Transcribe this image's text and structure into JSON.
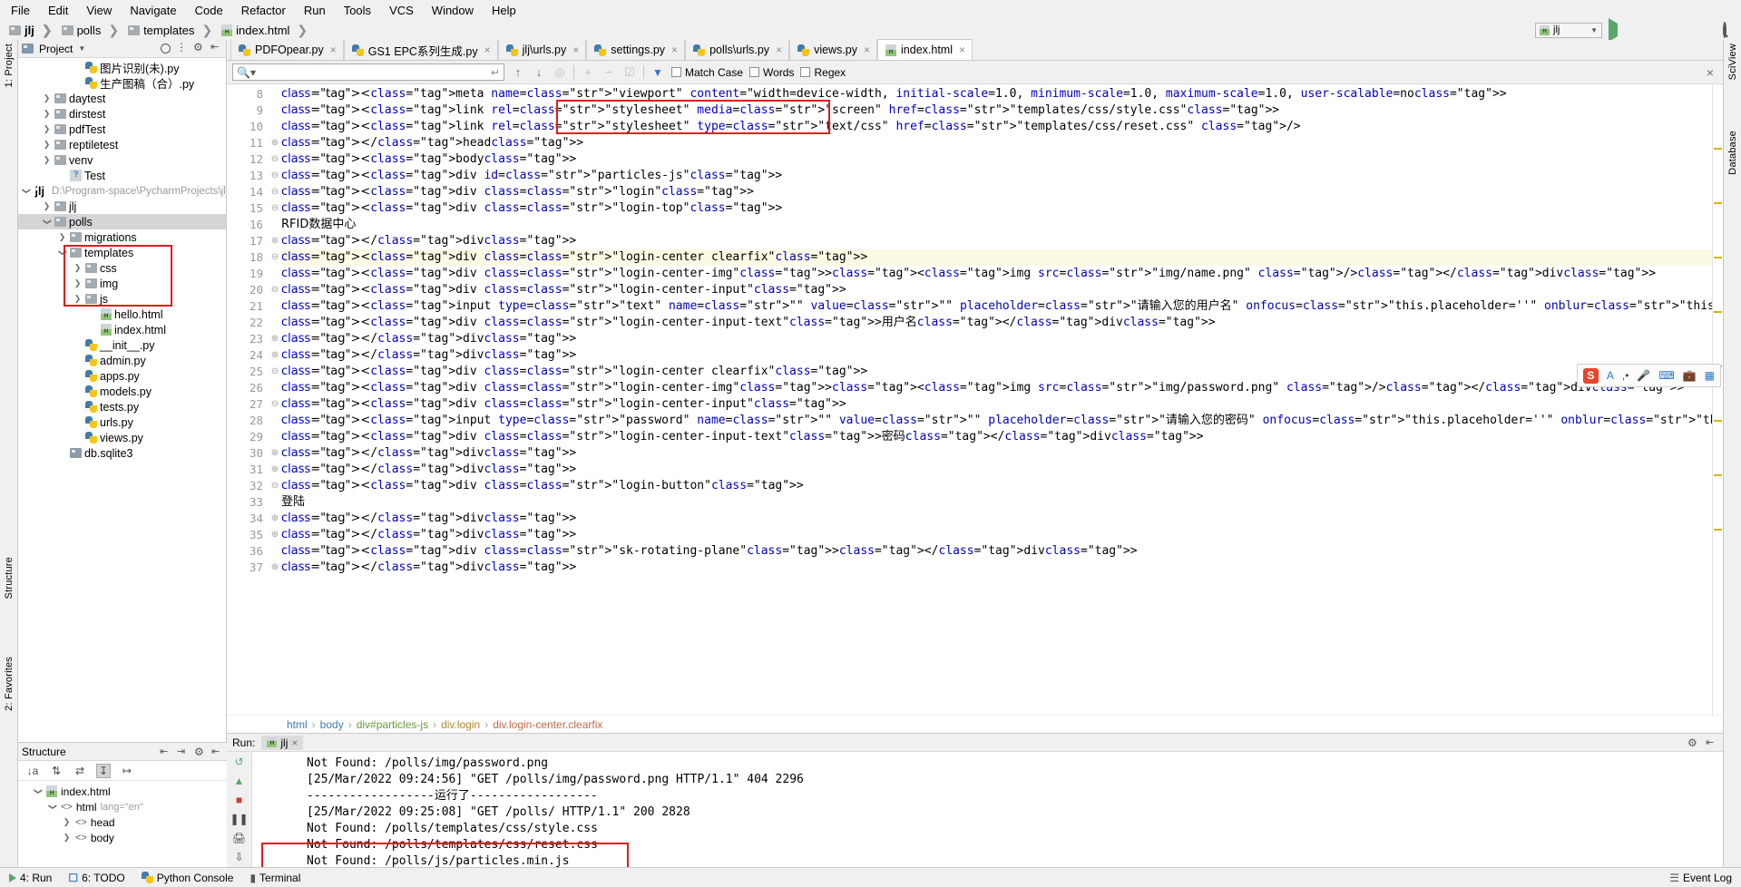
{
  "menubar": {
    "items": [
      "File",
      "Edit",
      "View",
      "Navigate",
      "Code",
      "Refactor",
      "Run",
      "Tools",
      "VCS",
      "Window",
      "Help"
    ]
  },
  "breadcrumb": {
    "items": [
      "jlj",
      "polls",
      "templates",
      "index.html"
    ]
  },
  "toprightbar": {
    "run_config": "jlj",
    "icons": [
      "run-icon",
      "debug-icon",
      "coverage-icon",
      "profile-icon",
      "build-icon",
      "stop-icon",
      "search-everywhere-icon"
    ]
  },
  "project_panel": {
    "title": "Project",
    "tree": [
      {
        "indent": 3,
        "arrow": "none",
        "icon": "python-file-icon",
        "label": "图片识别(未).py",
        "path": ""
      },
      {
        "indent": 3,
        "arrow": "none",
        "icon": "python-file-icon",
        "label": "生产图稿（合）.py",
        "path": ""
      },
      {
        "indent": 1,
        "arrow": "right",
        "icon": "folder-icon",
        "label": "daytest",
        "path": ""
      },
      {
        "indent": 1,
        "arrow": "right",
        "icon": "folder-icon",
        "label": "dirstest",
        "path": ""
      },
      {
        "indent": 1,
        "arrow": "right",
        "icon": "folder-icon",
        "label": "pdfTest",
        "path": ""
      },
      {
        "indent": 1,
        "arrow": "right",
        "icon": "folder-icon",
        "label": "reptiletest",
        "path": ""
      },
      {
        "indent": 1,
        "arrow": "right",
        "icon": "folder-icon",
        "label": "venv",
        "path": ""
      },
      {
        "indent": 2,
        "arrow": "none",
        "icon": "unknown-file-icon",
        "label": "Test",
        "path": ""
      },
      {
        "indent": 0,
        "arrow": "down",
        "icon": "module-icon",
        "label": "jlj",
        "path": "D:\\Program-space\\PycharmProjects\\jlj",
        "bold": true
      },
      {
        "indent": 1,
        "arrow": "right",
        "icon": "folder-icon",
        "label": "jlj",
        "path": ""
      },
      {
        "indent": 1,
        "arrow": "down",
        "icon": "folder-icon",
        "label": "polls",
        "path": "",
        "selected": true
      },
      {
        "indent": 2,
        "arrow": "right",
        "icon": "folder-icon",
        "label": "migrations",
        "path": ""
      },
      {
        "indent": 2,
        "arrow": "down",
        "icon": "folder-icon",
        "label": "templates",
        "path": ""
      },
      {
        "indent": 3,
        "arrow": "right",
        "icon": "folder-icon",
        "label": "css",
        "path": ""
      },
      {
        "indent": 3,
        "arrow": "right",
        "icon": "folder-icon",
        "label": "img",
        "path": ""
      },
      {
        "indent": 3,
        "arrow": "right",
        "icon": "folder-icon",
        "label": "js",
        "path": ""
      },
      {
        "indent": 4,
        "arrow": "none",
        "icon": "html-file-icon",
        "label": "hello.html",
        "path": ""
      },
      {
        "indent": 4,
        "arrow": "none",
        "icon": "html-file-icon",
        "label": "index.html",
        "path": ""
      },
      {
        "indent": 3,
        "arrow": "none",
        "icon": "python-file-icon",
        "label": "__init__.py",
        "path": ""
      },
      {
        "indent": 3,
        "arrow": "none",
        "icon": "python-file-icon",
        "label": "admin.py",
        "path": ""
      },
      {
        "indent": 3,
        "arrow": "none",
        "icon": "python-file-icon",
        "label": "apps.py",
        "path": ""
      },
      {
        "indent": 3,
        "arrow": "none",
        "icon": "python-file-icon",
        "label": "models.py",
        "path": ""
      },
      {
        "indent": 3,
        "arrow": "none",
        "icon": "python-file-icon",
        "label": "tests.py",
        "path": ""
      },
      {
        "indent": 3,
        "arrow": "none",
        "icon": "python-file-icon",
        "label": "urls.py",
        "path": ""
      },
      {
        "indent": 3,
        "arrow": "none",
        "icon": "python-file-icon",
        "label": "views.py",
        "path": ""
      },
      {
        "indent": 2,
        "arrow": "none",
        "icon": "db-file-icon",
        "label": "db.sqlite3",
        "path": ""
      }
    ]
  },
  "structure_panel": {
    "title": "Structure",
    "tree": [
      {
        "indent": 0,
        "arrow": "down",
        "icon": "html-file-icon",
        "label": "index.html",
        "attr": ""
      },
      {
        "indent": 1,
        "arrow": "down",
        "icon": "tag-icon",
        "label": "html",
        "attr": "lang=\"en\""
      },
      {
        "indent": 2,
        "arrow": "right",
        "icon": "tag-icon",
        "label": "head",
        "attr": ""
      },
      {
        "indent": 2,
        "arrow": "right",
        "icon": "tag-icon",
        "label": "body",
        "attr": ""
      }
    ]
  },
  "editor_tabs": [
    {
      "label": "PDFOpear.py",
      "icon": "python-file-icon",
      "active": false
    },
    {
      "label": "GS1 EPC系列生成.py",
      "icon": "python-file-icon",
      "active": false
    },
    {
      "label": "jlj\\urls.py",
      "icon": "python-file-icon",
      "active": false
    },
    {
      "label": "settings.py",
      "icon": "python-file-icon",
      "active": false
    },
    {
      "label": "polls\\urls.py",
      "icon": "python-file-icon",
      "active": false
    },
    {
      "label": "views.py",
      "icon": "python-file-icon",
      "active": false
    },
    {
      "label": "index.html",
      "icon": "html-file-icon",
      "active": true
    }
  ],
  "findbar": {
    "query": "",
    "match_case": "Match Case",
    "words": "Words",
    "regex": "Regex",
    "icons": [
      "prev-match-icon",
      "next-match-icon",
      "select-all-icon",
      "add-icon",
      "remove-icon",
      "select-occurrences-icon",
      "filter-icon",
      "close-icon"
    ]
  },
  "editor": {
    "first_line": 8,
    "lines": [
      {
        "n": 8,
        "fold": "none",
        "text": "<meta name=\"viewport\" content=\"width=device-width, initial-scale=1.0, minimum-scale=1.0, maximum-scale=1.0, user-scalable=no>"
      },
      {
        "n": 9,
        "fold": "none",
        "text": "<link rel=\"stylesheet\" media=\"screen\" href=\"templates/css/style.css\">"
      },
      {
        "n": 10,
        "fold": "none",
        "text": "<link rel=\"stylesheet\" type=\"text/css\" href=\"templates/css/reset.css\" />"
      },
      {
        "n": 11,
        "fold": "end",
        "text": "</head>"
      },
      {
        "n": 12,
        "fold": "start",
        "text": "<body>"
      },
      {
        "n": 13,
        "fold": "start",
        "text": "<div id=\"particles-js\">"
      },
      {
        "n": 14,
        "fold": "start",
        "text": "<div class=\"login\">"
      },
      {
        "n": 15,
        "fold": "start",
        "text": "<div class=\"login-top\">"
      },
      {
        "n": 16,
        "fold": "none",
        "text": "RFID数据中心"
      },
      {
        "n": 17,
        "fold": "end",
        "text": "</div>"
      },
      {
        "n": 18,
        "fold": "start",
        "text": "<div class=\"login-center clearfix\">",
        "highlight": true
      },
      {
        "n": 19,
        "fold": "none",
        "text": "<div class=\"login-center-img\"><img src=\"img/name.png\" /></div>"
      },
      {
        "n": 20,
        "fold": "start",
        "text": "<div class=\"login-center-input\">"
      },
      {
        "n": 21,
        "fold": "none",
        "text": "<input type=\"text\" name=\"\" value=\"\" placeholder=\"请输入您的用户名\" onfocus=\"this.placeholder=''\" onblur=\"this.placeholder='请输入您的用户名'\" />"
      },
      {
        "n": 22,
        "fold": "none",
        "text": "<div class=\"login-center-input-text\">用户名</div>"
      },
      {
        "n": 23,
        "fold": "end",
        "text": "</div>"
      },
      {
        "n": 24,
        "fold": "end",
        "text": "</div>"
      },
      {
        "n": 25,
        "fold": "start",
        "text": "<div class=\"login-center clearfix\">"
      },
      {
        "n": 26,
        "fold": "none",
        "text": "<div class=\"login-center-img\"><img src=\"img/password.png\" /></div>"
      },
      {
        "n": 27,
        "fold": "start",
        "text": "<div class=\"login-center-input\">"
      },
      {
        "n": 28,
        "fold": "none",
        "text": "<input type=\"password\" name=\"\" value=\"\" placeholder=\"请输入您的密码\" onfocus=\"this.placeholder=''\" onblur=\"this.placeholder='请输入您的密码'\" />"
      },
      {
        "n": 29,
        "fold": "none",
        "text": "<div class=\"login-center-input-text\">密码</div>"
      },
      {
        "n": 30,
        "fold": "end",
        "text": "</div>"
      },
      {
        "n": 31,
        "fold": "end",
        "text": "</div>"
      },
      {
        "n": 32,
        "fold": "start",
        "text": "<div class=\"login-button\">"
      },
      {
        "n": 33,
        "fold": "none",
        "text": "登陆"
      },
      {
        "n": 34,
        "fold": "end",
        "text": "</div>"
      },
      {
        "n": 35,
        "fold": "end",
        "text": "</div>"
      },
      {
        "n": 36,
        "fold": "none",
        "text": "<div class=\"sk-rotating-plane\"></div>"
      },
      {
        "n": 37,
        "fold": "end",
        "text": "</div>"
      }
    ],
    "code_breadcrumb": [
      "html",
      "body",
      "div#particles-js",
      "div.login",
      "div.login-center.clearfix"
    ]
  },
  "run_panel": {
    "label": "Run:",
    "tab": "jlj",
    "console_lines": [
      "Not Found: /polls/img/password.png",
      "[25/Mar/2022 09:24:56] \"GET /polls/img/password.png HTTP/1.1\" 404 2296",
      "------------------运行了------------------",
      "[25/Mar/2022 09:25:08] \"GET /polls/ HTTP/1.1\" 200 2828",
      "Not Found: /polls/templates/css/style.css",
      "Not Found: /polls/templates/css/reset.css",
      "Not Found: /polls/js/particles.min.js"
    ]
  },
  "statusbar": {
    "items": [
      "4: Run",
      "6: TODO",
      "Python Console",
      "Terminal"
    ],
    "right_items": [
      "Event Log"
    ]
  },
  "left_rail": {
    "labels": [
      "1: Project",
      "Structure",
      "2: Favorites"
    ]
  },
  "right_rail": {
    "labels": [
      "SciView",
      "Database"
    ]
  },
  "sogou_toolbar": {
    "icons": [
      "sogou-logo-icon",
      "lang-A-icon",
      "punctuation-icon",
      "mic-icon",
      "keyboard-icon",
      "toolbox-icon",
      "menu-icon"
    ]
  },
  "colors": {
    "accent": "#2d77c4",
    "annotation_red": "#e21b1b",
    "tag_blue": "#000080",
    "string_green": "#008000",
    "attr_blue": "#0000c0"
  }
}
